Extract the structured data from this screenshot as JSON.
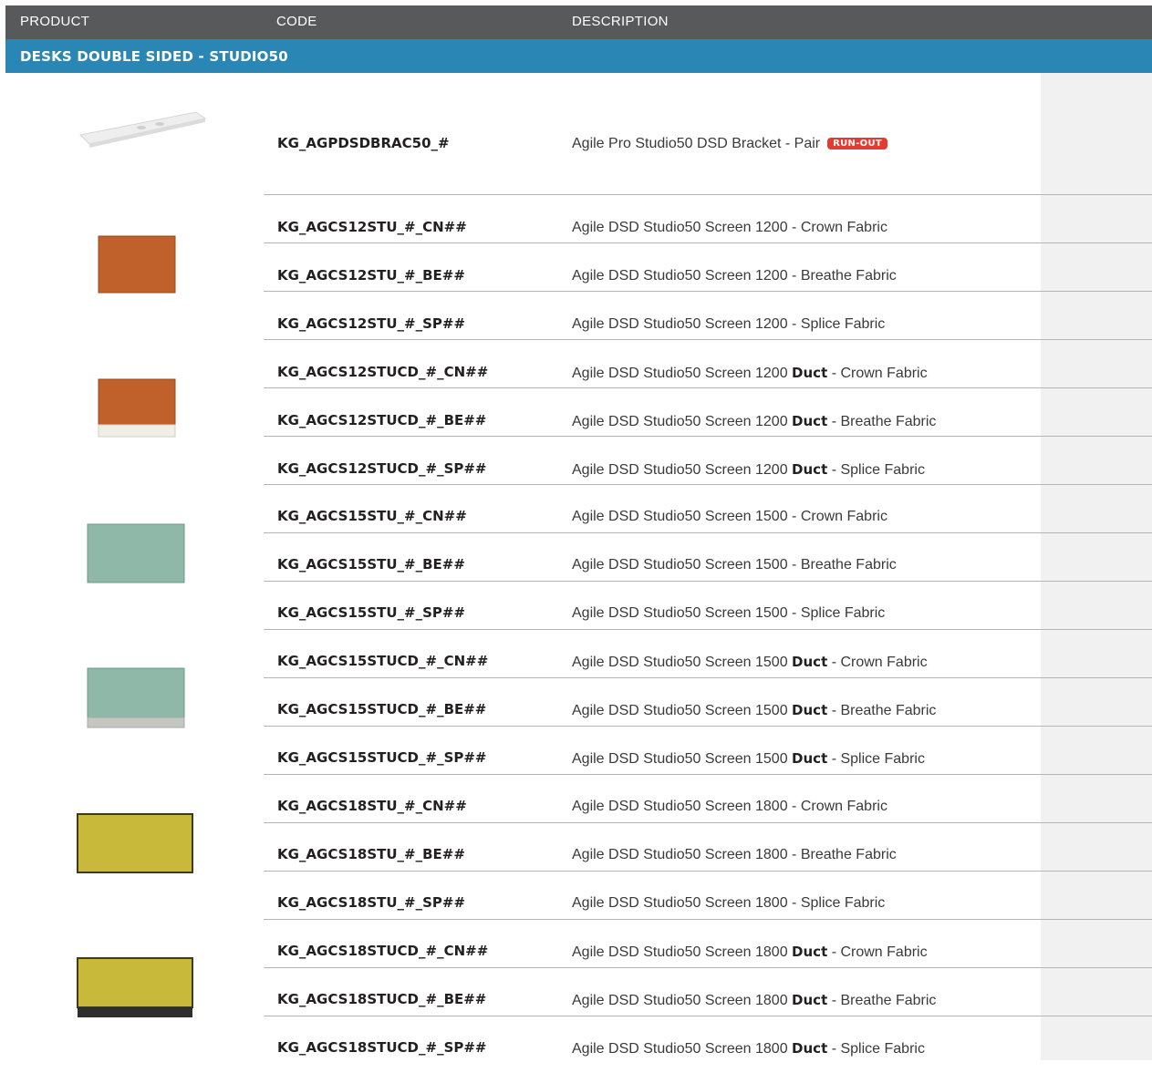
{
  "header": {
    "product": "PRODUCT",
    "code": "CODE",
    "description": "DESCRIPTION"
  },
  "category": "DESKS DOUBLE SIDED - STUDIO50",
  "rows": [
    {
      "code": "KG_AGPDSDBRAC50_#",
      "desc": "Agile Pro Studio50 DSD Bracket - Pair",
      "badge": "RUN-OUT"
    },
    {
      "code": "KG_AGCS12STU_#_CN##",
      "desc": "Agile DSD Studio50 Screen 1200 - Crown Fabric"
    },
    {
      "code": "KG_AGCS12STU_#_BE##",
      "desc": "Agile DSD Studio50 Screen 1200 - Breathe Fabric"
    },
    {
      "code": "KG_AGCS12STU_#_SP##",
      "desc": "Agile DSD Studio50 Screen 1200 - Splice Fabric"
    },
    {
      "code": "KG_AGCS12STUCD_#_CN##",
      "desc_pre": "Agile DSD Studio50 Screen 1200 ",
      "desc_bold": "Duct",
      "desc_post": " - Crown Fabric"
    },
    {
      "code": "KG_AGCS12STUCD_#_BE##",
      "desc_pre": "Agile DSD Studio50 Screen 1200 ",
      "desc_bold": "Duct",
      "desc_post": " - Breathe Fabric"
    },
    {
      "code": "KG_AGCS12STUCD_#_SP##",
      "desc_pre": "Agile DSD Studio50 Screen 1200 ",
      "desc_bold": "Duct",
      "desc_post": " - Splice Fabric"
    },
    {
      "code": "KG_AGCS15STU_#_CN##",
      "desc": "Agile DSD Studio50 Screen 1500 - Crown Fabric"
    },
    {
      "code": "KG_AGCS15STU_#_BE##",
      "desc": "Agile DSD Studio50 Screen 1500 - Breathe Fabric"
    },
    {
      "code": "KG_AGCS15STU_#_SP##",
      "desc": "Agile DSD Studio50 Screen 1500 - Splice Fabric"
    },
    {
      "code": "KG_AGCS15STUCD_#_CN##",
      "desc_pre": "Agile DSD Studio50 Screen 1500 ",
      "desc_bold": "Duct",
      "desc_post": " - Crown Fabric"
    },
    {
      "code": "KG_AGCS15STUCD_#_BE##",
      "desc_pre": "Agile DSD Studio50 Screen 1500 ",
      "desc_bold": "Duct",
      "desc_post": " - Breathe Fabric"
    },
    {
      "code": "KG_AGCS15STUCD_#_SP##",
      "desc_pre": "Agile DSD Studio50 Screen 1500 ",
      "desc_bold": "Duct",
      "desc_post": " - Splice Fabric"
    },
    {
      "code": "KG_AGCS18STU_#_CN##",
      "desc": "Agile DSD Studio50 Screen 1800 - Crown Fabric"
    },
    {
      "code": "KG_AGCS18STU_#_BE##",
      "desc": "Agile DSD Studio50 Screen 1800 - Breathe Fabric"
    },
    {
      "code": "KG_AGCS18STU_#_SP##",
      "desc": "Agile DSD Studio50 Screen 1800 - Splice Fabric"
    },
    {
      "code": "KG_AGCS18STUCD_#_CN##",
      "desc_pre": "Agile DSD Studio50 Screen 1800 ",
      "desc_bold": "Duct",
      "desc_post": " - Crown Fabric"
    },
    {
      "code": "KG_AGCS18STUCD_#_BE##",
      "desc_pre": "Agile DSD Studio50 Screen 1800 ",
      "desc_bold": "Duct",
      "desc_post": " - Breathe Fabric"
    },
    {
      "code": "KG_AGCS18STUCD_#_SP##",
      "desc_pre": "Agile DSD Studio50 Screen 1800 ",
      "desc_bold": "Duct",
      "desc_post": " - Splice Fabric"
    }
  ],
  "colors": {
    "header_bg": "#58595b",
    "category_bg": "#2a86b5",
    "badge_bg": "#e53a2f",
    "screen_orange": "#c0602a",
    "screen_green": "#8fb8a8",
    "screen_yellow": "#c9b93a"
  }
}
